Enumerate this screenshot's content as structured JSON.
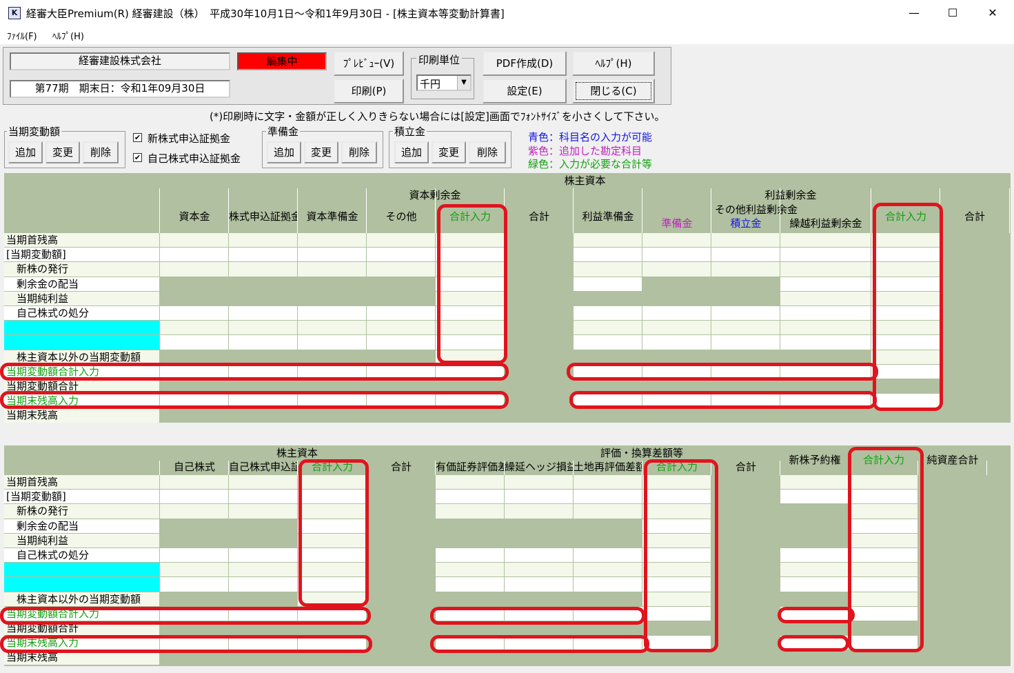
{
  "window": {
    "title": "経審大臣Premium(R) 経審建設（株）　平成30年10月1日～令和1年9月30日 - [株主資本等変動計算書]",
    "icon": "app-icon",
    "minimize": "—",
    "maximize": "☐",
    "close": "✕"
  },
  "menu": {
    "file": "ﾌｧｲﾙ(F)",
    "help": "ﾍﾙﾌﾟ(H)"
  },
  "toolbar": {
    "company": "経審建設株式会社",
    "period": "第77期　期末日：令和1年09月30日",
    "status": "編集中",
    "preview": "ﾌﾟﾚﾋﾞｭｰ(V)",
    "print": "印刷(P)",
    "unit_label": "印刷単位",
    "unit_value": "千円",
    "pdf": "PDF作成(D)",
    "settings": "設定(E)",
    "help": "ﾍﾙﾌﾟ(H)",
    "close": "閉じる(C)"
  },
  "notice": "(*)印刷時に文字・金額が正しく入りきらない場合には[設定]画面でﾌｫﾝﾄｻｲｽﾞを小さくして下さい。",
  "groups": {
    "current": {
      "label": "当期変動額",
      "add": "追加",
      "change": "変更",
      "delete": "削除"
    },
    "check1": "新株式申込証拠金",
    "check2": "自己株式申込証拠金",
    "reserve": {
      "label": "準備金",
      "add": "追加",
      "change": "変更",
      "delete": "削除"
    },
    "savings": {
      "label": "積立金",
      "add": "追加",
      "change": "変更",
      "delete": "削除"
    }
  },
  "legend": {
    "blue": "青色：科目名の入力が可能",
    "purple": "紫色：追加した勘定科目",
    "green": "緑色：入力が必要な合計等"
  },
  "colors": {
    "green_cell": "#b0c0a0",
    "light_cell": "#f3f8ea",
    "cyan": "#00ffff",
    "highlight": "#e0141e"
  },
  "rows": [
    "当期首残高",
    "[当期変動額]",
    "　新株の発行",
    "　剰余金の配当",
    "　当期純利益",
    "　自己株式の処分",
    "",
    "",
    "　株主資本以外の当期変動額",
    "当期変動額合計入力",
    "当期変動額合計",
    "当期末残高入力",
    "当期末残高"
  ],
  "table1": {
    "top": "株主資本",
    "capital_surplus": "資本剰余金",
    "retained": "利益剰余金",
    "other_retained": "その他利益剰余金",
    "cols": [
      "資本金",
      "株式申込証拠金",
      "資本準備金",
      "その他",
      "合計入力",
      "合計",
      "利益準備金",
      "準備金",
      "積立金",
      "繰越利益剰余金",
      "合計入力",
      "合計"
    ]
  },
  "table2": {
    "shareholders": "株主資本",
    "valuation": "評価・換算差額等",
    "cols": [
      "自己株式",
      "自己株式申込証拠金",
      "合計入力",
      "合計",
      "有価証券評価差額金",
      "繰延ヘッジ損益",
      "土地再評価差額金",
      "合計入力",
      "合計",
      "新株予約権",
      "合計入力",
      "純資産合計"
    ]
  }
}
